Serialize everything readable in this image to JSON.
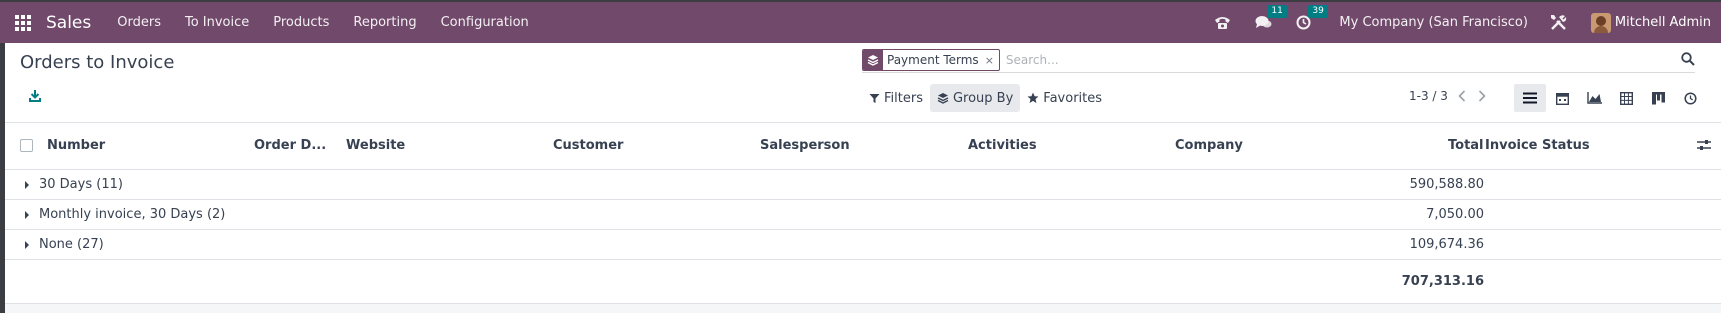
{
  "navbar": {
    "app_name": "Sales",
    "menu": [
      {
        "label": "Orders"
      },
      {
        "label": "To Invoice"
      },
      {
        "label": "Products"
      },
      {
        "label": "Reporting"
      },
      {
        "label": "Configuration"
      }
    ],
    "messages_count": "11",
    "activities_count": "39",
    "company": "My Company (San Francisco)",
    "user": "Mitchell Admin"
  },
  "control_panel": {
    "title": "Orders to Invoice",
    "facet_label": "Payment Terms",
    "facet_remove": "×",
    "search_placeholder": "Search...",
    "filters_label": "Filters",
    "group_by_label": "Group By",
    "favorites_label": "Favorites",
    "pager": "1-3 / 3"
  },
  "list": {
    "columns": [
      {
        "label": "Number"
      },
      {
        "label": "Order D..."
      },
      {
        "label": "Website"
      },
      {
        "label": "Customer"
      },
      {
        "label": "Salesperson"
      },
      {
        "label": "Activities"
      },
      {
        "label": "Company"
      },
      {
        "label": "Total"
      },
      {
        "label": "Invoice Status"
      }
    ],
    "groups": [
      {
        "label": "30 Days (11)",
        "total": "590,588.80"
      },
      {
        "label": "Monthly invoice, 30 Days (2)",
        "total": "7,050.00"
      },
      {
        "label": "None (27)",
        "total": "109,674.36"
      }
    ],
    "grand_total": "707,313.16"
  },
  "colors": {
    "brand": "#71496b",
    "accent": "#017e84"
  },
  "icons": [
    "apps-grid-icon",
    "phone-icon",
    "chat-icon",
    "clock-icon",
    "tools-icon",
    "download-icon",
    "layers-icon",
    "search-icon",
    "filter-icon",
    "star-icon",
    "list-view-icon",
    "calendar-view-icon",
    "graph-view-icon",
    "pivot-view-icon",
    "kanban-view-icon",
    "activity-view-icon",
    "optional-columns-icon"
  ]
}
